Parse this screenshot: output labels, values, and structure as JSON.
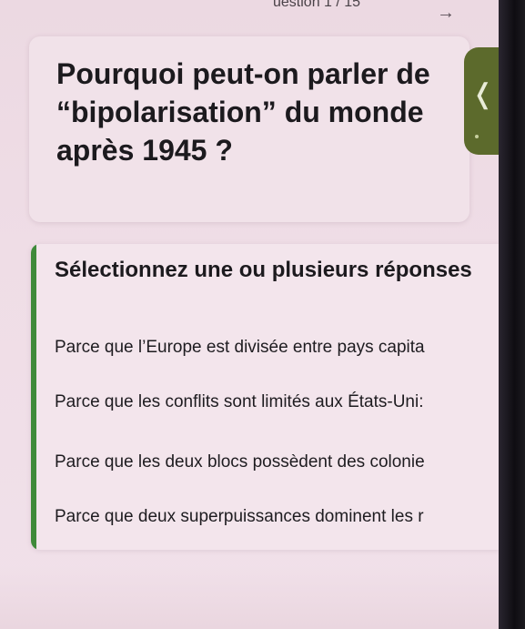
{
  "header": {
    "question_counter": "uestion 1 / 15",
    "next_icon": "arrow-right-icon"
  },
  "question": {
    "title": "Pourquoi peut-on parler de “bipolarisation” du monde après 1945 ?"
  },
  "side_tab": {
    "icon": "chevron-left-icon",
    "glyph": "❬",
    "color": "#5c6a2c"
  },
  "answers": {
    "instruction": "Sélectionnez une ou plusieurs réponses",
    "accent_color": "#3f8a3a",
    "options": [
      "Parce que l’Europe est divisée entre pays capita",
      "Parce que les conflits sont limités aux États-Uni:",
      "Parce que les deux blocs possèdent des colonie",
      "Parce que deux superpuissances dominent les r"
    ]
  }
}
